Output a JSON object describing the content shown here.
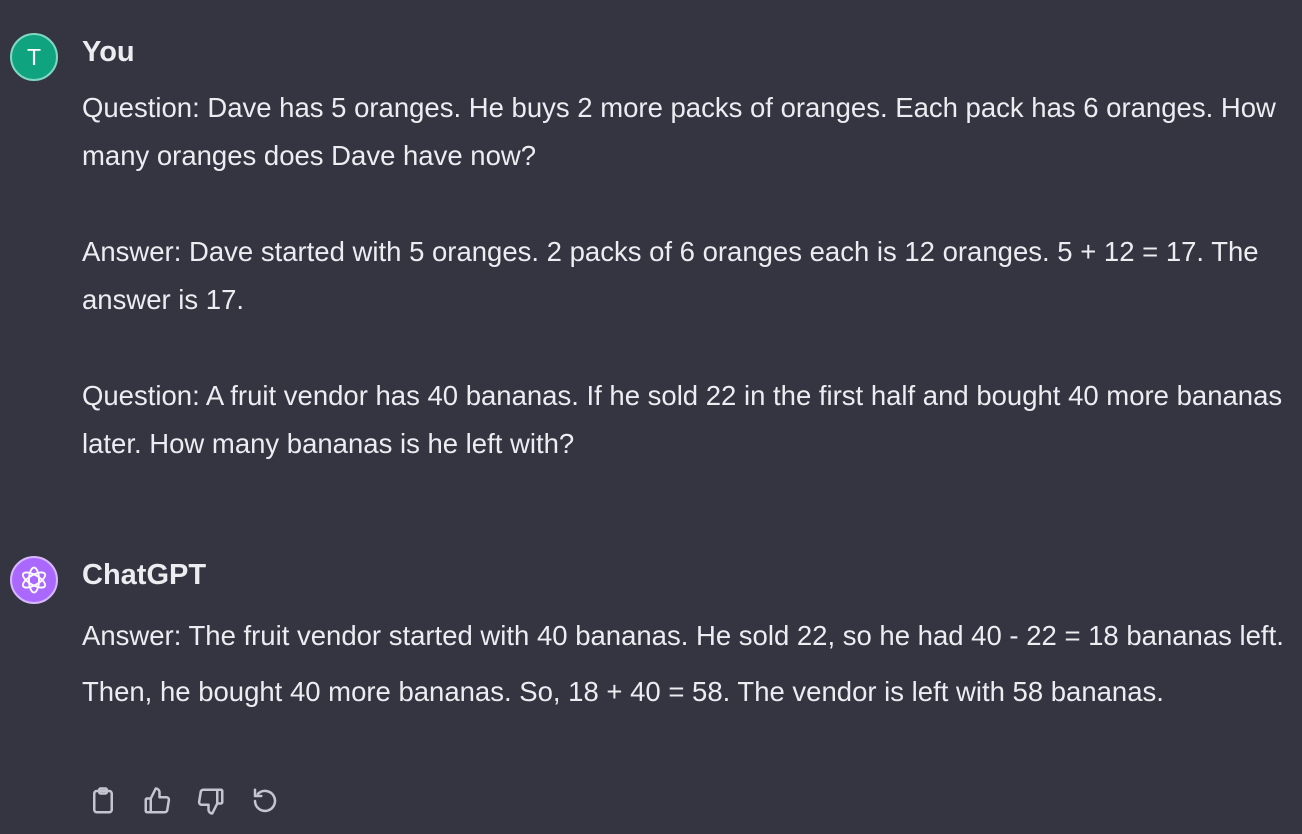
{
  "conversation": {
    "user": {
      "author": "You",
      "avatar_initial": "T",
      "avatar_color": "#10a37f",
      "paragraphs": [
        "Question: Dave has 5 oranges. He buys 2 more packs of oranges. Each pack has 6 oranges. How many oranges does Dave have now?",
        "Answer: Dave started with 5 oranges. 2 packs of 6 oranges each is 12 oranges. 5 + 12 = 17. The answer is 17.",
        "Question: A fruit vendor has 40 bananas. If he sold 22 in the first half and bought 40 more bananas later. How many bananas is he left with?"
      ]
    },
    "assistant": {
      "author": "ChatGPT",
      "avatar_icon": "openai-logo-icon",
      "avatar_color": "#ab68ff",
      "text": "Answer: The fruit vendor started with 40 bananas. He sold 22, so he had 40 - 22 = 18 bananas left. Then, he bought 40 more bananas. So, 18 + 40 = 58. The vendor is left with 58 bananas.",
      "actions": [
        "clipboard-icon",
        "thumbs-up-icon",
        "thumbs-down-icon",
        "regenerate-icon"
      ]
    }
  },
  "theme": {
    "background": "#343541",
    "text": "#ececf1",
    "icon": "#c5c5d2"
  }
}
